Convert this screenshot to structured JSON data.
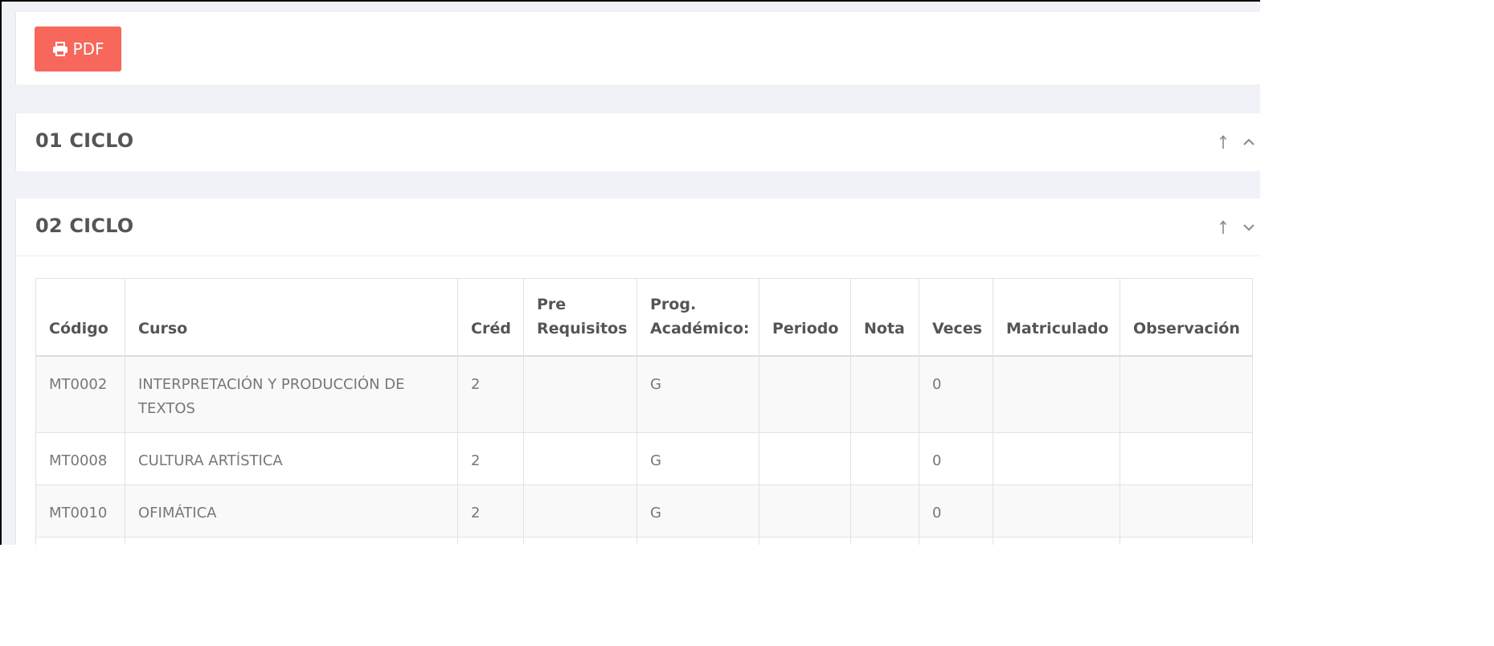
{
  "toolbar": {
    "pdf_label": "PDF",
    "pdf_icon": "printer-icon",
    "pdf_color": "#f7675c"
  },
  "panels": [
    {
      "title": "01 CICLO",
      "actions": [
        "arrow-up-icon",
        "chevron-up-icon"
      ]
    },
    {
      "title": "02 CICLO",
      "actions": [
        "arrow-up-icon",
        "chevron-down-icon"
      ]
    }
  ],
  "table": {
    "headers": {
      "codigo": "Código",
      "curso": "Curso",
      "cred": "Créd",
      "prereq_line1": "Pre",
      "prereq_line2": "Requisitos",
      "prog_line1": "Prog.",
      "prog_line2": "Académico:",
      "periodo": "Periodo",
      "nota": "Nota",
      "veces": "Veces",
      "matriculado": "Matriculado",
      "observacion": "Observación"
    },
    "rows": [
      {
        "codigo": "MT0002",
        "curso": "INTERPRETACIÓN Y PRODUCCIÓN DE TEXTOS",
        "cred": "2",
        "prereq": "",
        "prog": "G",
        "periodo": "",
        "nota": "",
        "veces": "0",
        "matriculado": "",
        "observacion": ""
      },
      {
        "codigo": "MT0008",
        "curso": "CULTURA ARTÍSTICA",
        "cred": "2",
        "prereq": "",
        "prog": "G",
        "periodo": "",
        "nota": "",
        "veces": "0",
        "matriculado": "",
        "observacion": ""
      },
      {
        "codigo": "MT0010",
        "curso": "OFIMÁTICA",
        "cred": "2",
        "prereq": "",
        "prog": "G",
        "periodo": "",
        "nota": "",
        "veces": "0",
        "matriculado": "",
        "observacion": ""
      }
    ]
  }
}
